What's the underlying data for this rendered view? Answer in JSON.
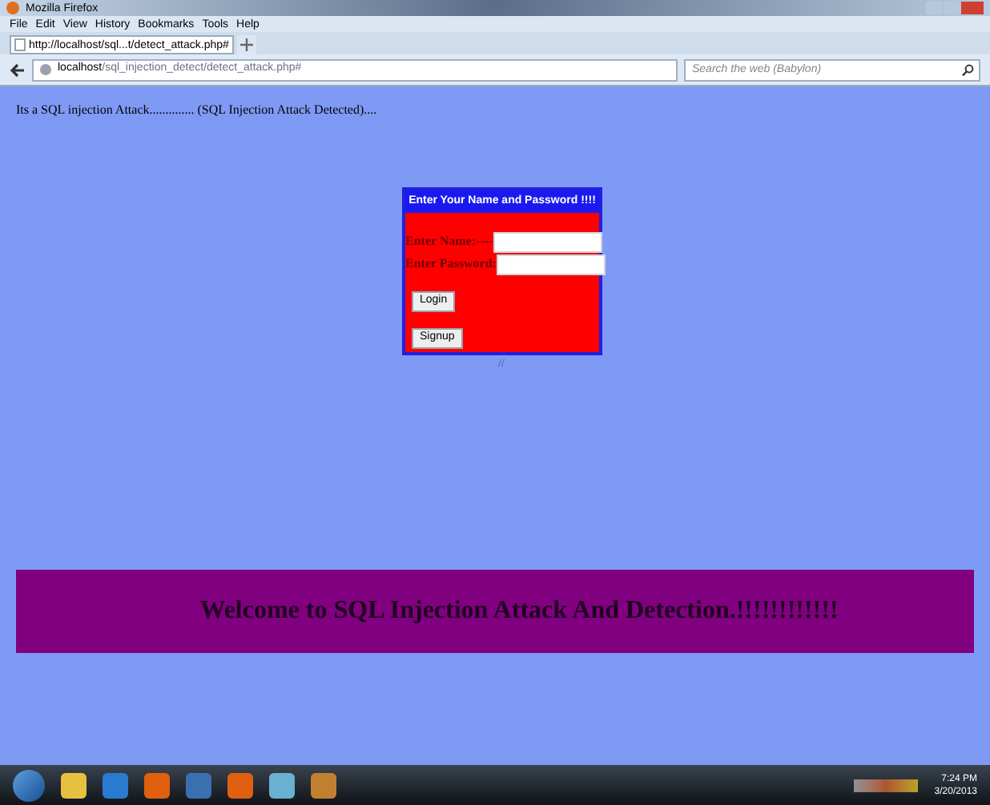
{
  "window": {
    "title": "Mozilla Firefox"
  },
  "menu": [
    "File",
    "Edit",
    "View",
    "History",
    "Bookmarks",
    "Tools",
    "Help"
  ],
  "tabs": [
    {
      "label": "http://localhost/sql...t/detect_attack.php#",
      "selected": true
    }
  ],
  "address_bar": {
    "host": "localhost",
    "path": "/sql_injection_detect/detect_attack.php#"
  },
  "search": {
    "placeholder": "Search the web (Babylon)"
  },
  "page": {
    "message": "Its a SQL injection Attack.............. (SQL Injection Attack Detected)....",
    "form": {
      "title": "Enter Your Name and Password !!!!",
      "fields": [
        {
          "label": "Enter Name:----"
        },
        {
          "label": "Enter Password:"
        }
      ],
      "buttons": [
        "Login",
        "Signup"
      ]
    },
    "mark": "//",
    "banner": "Welcome to SQL Injection Attack And Detection.!!!!!!!!!!!!"
  },
  "taskbar": {
    "apps": [
      {
        "color": "#e8c040"
      },
      {
        "color": "#2a7ad0"
      },
      {
        "color": "#e06010"
      },
      {
        "color": "#3a6fb0"
      },
      {
        "color": "#e06010"
      },
      {
        "color": "#6ab0d0"
      },
      {
        "color": "#c08030"
      }
    ],
    "time": "7:24 PM",
    "date": "3/20/2013"
  }
}
